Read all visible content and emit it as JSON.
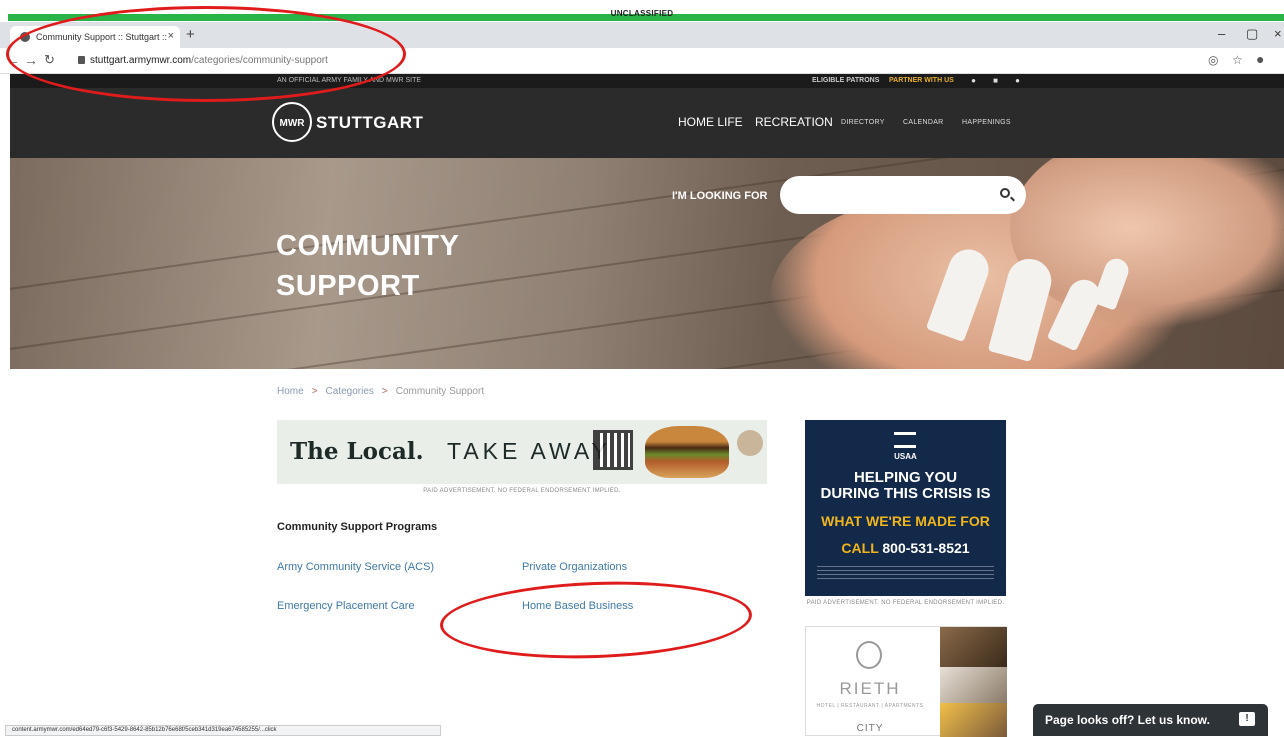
{
  "classification": {
    "label": "UNCLASSIFIED"
  },
  "browser": {
    "tab_title": "Community Support :: Stuttgart ::",
    "tab_close": "×",
    "new_tab": "+",
    "url_host": "stuttgart.armymwr.com",
    "url_path": "/categories/community-support",
    "window_controls": {
      "minimize": "–",
      "restore": "▢",
      "close": "×"
    },
    "status_url": "content.armymwr.com/ed64ed79-c6f3-5429-8642-85b12b76e68f/5ceb341d319ea674585255/...click"
  },
  "site_top": {
    "official": "AN OFFICIAL ARMY FAMILY AND MWR SITE",
    "eligible": "ELIGIBLE PATRONS",
    "partner": "PARTNER WITH US"
  },
  "header": {
    "logo_badge": "MWR",
    "logo_text": "STUTTGART",
    "nav": {
      "home_life": "HOME LIFE",
      "recreation": "RECREATION",
      "directory": "DIRECTORY",
      "calendar": "CALENDAR",
      "happenings": "HAPPENINGS"
    }
  },
  "hero": {
    "looking_for": "I'M LOOKING FOR",
    "title_line1": "COMMUNITY",
    "title_line2": "SUPPORT"
  },
  "breadcrumb": {
    "home": "Home",
    "categories": "Categories",
    "current": "Community Support",
    "sep": ">"
  },
  "ad_local": {
    "bold": "The Local.",
    "thin": "TAKE AWAY",
    "disclaimer": "PAID ADVERTISEMENT. NO FEDERAL ENDORSEMENT IMPLIED."
  },
  "programs": {
    "heading": "Community Support Programs",
    "links": {
      "acs": "Army Community Service (ACS)",
      "private_orgs": "Private Organizations",
      "emergency": "Emergency Placement Care",
      "home_business": "Home Based Business"
    }
  },
  "ad_usaa": {
    "brand": "USAA",
    "line1": "HELPING YOU",
    "line2": "DURING THIS CRISIS IS",
    "line3": "WHAT WE'RE MADE FOR",
    "call_label": "CALL",
    "phone": "800-531-8521",
    "disclaimer": "PAID ADVERTISEMENT. NO FEDERAL ENDORSEMENT IMPLIED."
  },
  "ad_rieth": {
    "name": "RIETH",
    "sub": "HOTEL | RESTAURANT | APARTMENTS",
    "city": "CITY"
  },
  "feedback": {
    "label": "Page looks off? Let us know.",
    "icon": "!"
  },
  "colors": {
    "annotation_red": "#e01b1b",
    "classification_green": "#28b446",
    "link_blue": "#3f79a6",
    "partner_gold": "#e8b02a",
    "usaa_navy": "#12294a",
    "usaa_gold": "#f1b51c"
  }
}
